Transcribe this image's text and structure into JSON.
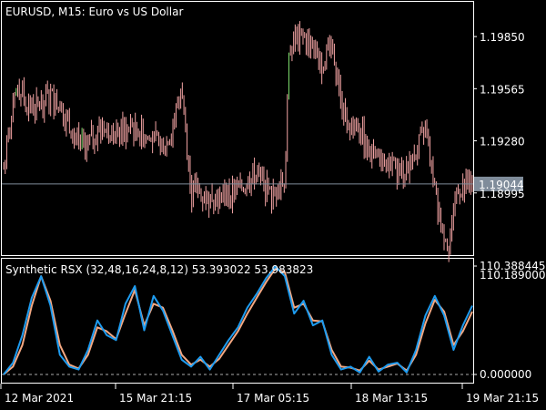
{
  "colors": {
    "background": "#000000",
    "axis": "#ffffff",
    "price_down": "#f2a3a3",
    "price_up": "#7ee06e",
    "price_line": "#7f8c9a",
    "price_tag_bg": "#7f8c9a",
    "rsx_fast": "#1e9cf0",
    "rsx_slow": "#f4a882",
    "level_line": "#aaaaaa"
  },
  "header": {
    "title": "EURUSD, M15:  Euro vs US Dollar",
    "indicator_label": "Synthetic RSX (32,48,16,24,8,12) 53.393022 53.983823"
  },
  "time_axis": [
    "12 Mar 2021",
    "15 Mar 21:15",
    "17 Mar 05:15",
    "18 Mar 13:15",
    "19 Mar 21:15"
  ],
  "chart_data": [
    {
      "type": "line",
      "title": "EURUSD, M15:  Euro vs US Dollar",
      "y_ticks": [
        1.1985,
        1.19565,
        1.1928,
        1.18995
      ],
      "current_price": 1.19044,
      "ylim": [
        1.1868,
        1.2002
      ],
      "x": [
        0,
        0.03,
        0.06,
        0.1,
        0.13,
        0.17,
        0.2,
        0.24,
        0.28,
        0.31,
        0.35,
        0.38,
        0.39,
        0.4,
        0.41,
        0.43,
        0.46,
        0.5,
        0.54,
        0.57,
        0.6,
        0.61,
        0.62,
        0.64,
        0.66,
        0.68,
        0.7,
        0.71,
        0.72,
        0.74,
        0.76,
        0.78,
        0.8,
        0.82,
        0.85,
        0.88,
        0.9,
        0.92,
        0.94,
        0.95,
        0.97,
        1.0
      ],
      "values": [
        1.1913,
        1.1958,
        1.1945,
        1.1953,
        1.1942,
        1.1925,
        1.1933,
        1.1932,
        1.1935,
        1.1928,
        1.1927,
        1.1955,
        1.193,
        1.1898,
        1.1902,
        1.1897,
        1.1897,
        1.19,
        1.191,
        1.1897,
        1.1907,
        1.198,
        1.1982,
        1.1985,
        1.1978,
        1.197,
        1.1986,
        1.1963,
        1.195,
        1.1935,
        1.1935,
        1.192,
        1.1917,
        1.1915,
        1.191,
        1.1922,
        1.1933,
        1.19,
        1.1878,
        1.1872,
        1.1902,
        1.1905
      ]
    },
    {
      "type": "line",
      "title": "Synthetic RSX (32,48,16,24,8,12) 53.393022 53.983823",
      "y_ticks": [
        110.388445,
        0.0
      ],
      "top_label": "110.388445",
      "top_label_overlap": "110.189000",
      "bottom_label": "0.000000",
      "ylim": [
        0,
        110.388445
      ],
      "x": [
        0,
        0.02,
        0.04,
        0.06,
        0.08,
        0.1,
        0.12,
        0.14,
        0.16,
        0.18,
        0.2,
        0.22,
        0.24,
        0.26,
        0.28,
        0.3,
        0.32,
        0.34,
        0.36,
        0.38,
        0.4,
        0.42,
        0.44,
        0.46,
        0.48,
        0.5,
        0.52,
        0.54,
        0.56,
        0.58,
        0.6,
        0.62,
        0.64,
        0.66,
        0.68,
        0.7,
        0.72,
        0.74,
        0.76,
        0.78,
        0.8,
        0.82,
        0.84,
        0.86,
        0.88,
        0.9,
        0.92,
        0.94,
        0.96,
        0.98,
        1.0
      ],
      "series": [
        {
          "values": [
            0,
            12,
            40,
            78,
            100,
            70,
            20,
            8,
            5,
            25,
            55,
            40,
            35,
            72,
            90,
            45,
            80,
            65,
            40,
            15,
            8,
            18,
            5,
            20,
            35,
            48,
            68,
            82,
            98,
            110,
            100,
            62,
            75,
            50,
            55,
            20,
            5,
            8,
            2,
            18,
            3,
            10,
            12,
            2,
            25,
            60,
            80,
            60,
            25,
            50,
            70
          ]
        },
        {
          "values": [
            0,
            8,
            30,
            70,
            100,
            75,
            30,
            10,
            6,
            20,
            48,
            44,
            36,
            62,
            86,
            50,
            72,
            68,
            45,
            20,
            10,
            15,
            8,
            16,
            30,
            44,
            62,
            78,
            94,
            108,
            104,
            68,
            72,
            55,
            54,
            25,
            8,
            7,
            4,
            14,
            5,
            8,
            11,
            4,
            20,
            52,
            76,
            64,
            30,
            44,
            64
          ]
        }
      ]
    }
  ]
}
